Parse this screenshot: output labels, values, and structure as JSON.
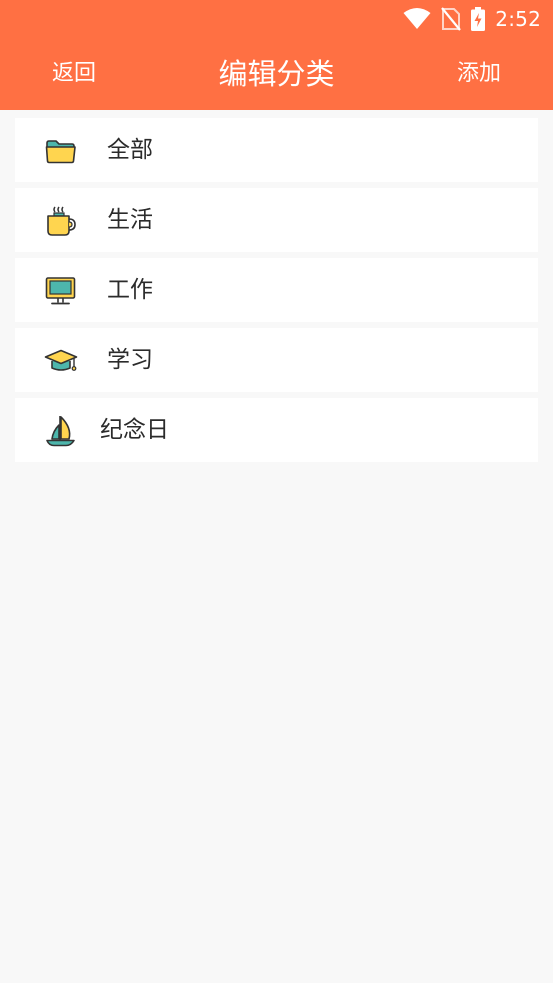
{
  "status_bar": {
    "time": "2:52",
    "icons": [
      "wifi-icon",
      "no-sim-icon",
      "battery-charging-icon"
    ]
  },
  "header": {
    "back_label": "返回",
    "title": "编辑分类",
    "add_label": "添加",
    "background": "#ff7043"
  },
  "categories": [
    {
      "label": "全部",
      "icon": "folder-icon"
    },
    {
      "label": "生活",
      "icon": "coffee-mug-icon"
    },
    {
      "label": "工作",
      "icon": "monitor-icon"
    },
    {
      "label": "学习",
      "icon": "graduation-cap-icon"
    },
    {
      "label": "纪念日",
      "icon": "sailboat-icon"
    }
  ]
}
